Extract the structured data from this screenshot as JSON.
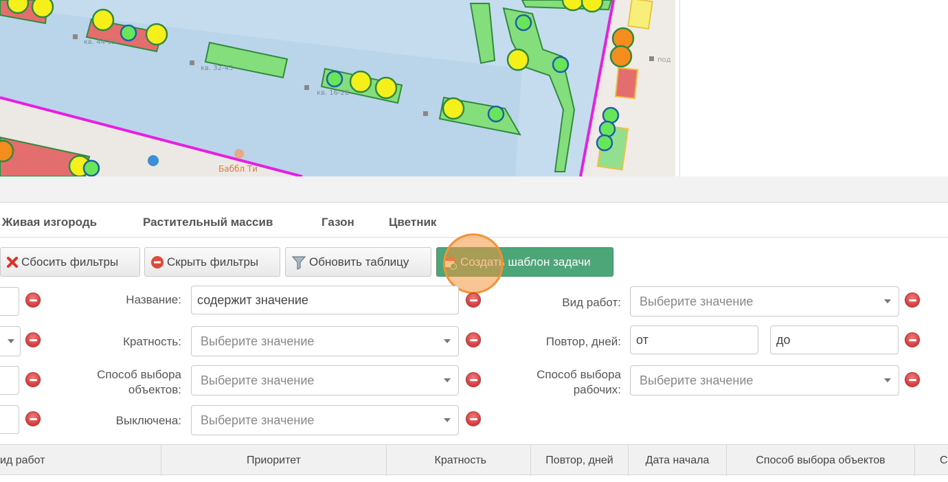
{
  "map": {
    "labels": [
      "Баббл Ти",
      "кв. 44-59",
      "кв. 32-43",
      "кв. 16-28",
      "под"
    ]
  },
  "tabs": [
    "Живая изгородь",
    "Растительный массив",
    "Газон",
    "Цветник"
  ],
  "toolbar": {
    "reset_filters": "Сбосить фильтры",
    "hide_filters": "Скрыть фильтры",
    "refresh_table": "Обновить таблицу",
    "create_template": "Создать шаблон задачи"
  },
  "filters": {
    "name_label": "Название:",
    "name_value": "содержит значение",
    "work_type_label": "Вид работ:",
    "work_type_placeholder": "Выберите значение",
    "frequency_label": "Кратность:",
    "frequency_placeholder": "Выберите значение",
    "repeat_label": "Повтор, дней:",
    "repeat_from": "от",
    "repeat_to": "до",
    "object_method_label": "Способ выбора объектов:",
    "object_method_placeholder": "Выберите значение",
    "worker_method_label": "Способ выбора рабочих:",
    "worker_method_placeholder": "Выберите значение",
    "disabled_label": "Выключена:",
    "disabled_placeholder": "Выберите значение"
  },
  "table": {
    "columns": [
      "ид работ",
      "Приоритет",
      "Кратность",
      "Повтор, дней",
      "Дата начала",
      "Способ выбора объектов",
      "С"
    ]
  },
  "colors": {
    "accent_green": "#4ca678",
    "highlight_orange": "#f29233",
    "remove_red": "#d63c3c",
    "boundary_magenta": "#e81ee0"
  }
}
